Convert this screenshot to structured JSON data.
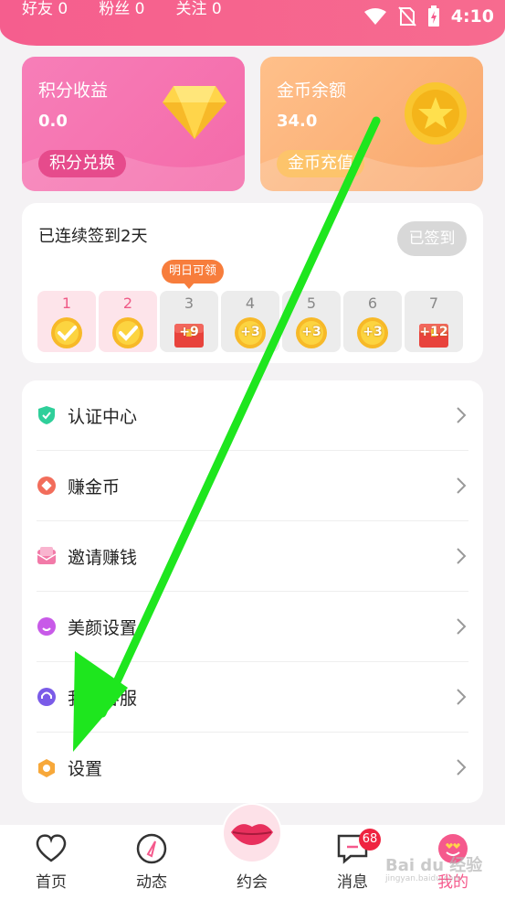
{
  "status": {
    "stats": [
      "好友 0",
      "粉丝 0",
      "关注 0"
    ],
    "time": "4:10"
  },
  "points_card": {
    "title": "积分收益",
    "value": "0.0",
    "button": "积分兑换"
  },
  "coin_card": {
    "title": "金币余额",
    "value": "34.0",
    "button": "金币充值"
  },
  "signin": {
    "title": "已连续签到2天",
    "button": "已签到",
    "tip": "明日可领",
    "days": [
      {
        "num": "1",
        "reward": "",
        "state": "done"
      },
      {
        "num": "2",
        "reward": "",
        "state": "done"
      },
      {
        "num": "3",
        "reward": "+9",
        "state": "chest"
      },
      {
        "num": "4",
        "reward": "+3",
        "state": "coin"
      },
      {
        "num": "5",
        "reward": "+3",
        "state": "coin"
      },
      {
        "num": "6",
        "reward": "+3",
        "state": "coin"
      },
      {
        "num": "7",
        "reward": "+12",
        "state": "chest"
      }
    ]
  },
  "menu": [
    {
      "label": "认证中心",
      "icon": "shield-check-icon"
    },
    {
      "label": "赚金币",
      "icon": "diamond-coin-icon"
    },
    {
      "label": "邀请赚钱",
      "icon": "envelope-icon"
    },
    {
      "label": "美颜设置",
      "icon": "beauty-face-icon"
    },
    {
      "label": "我的客服",
      "icon": "headset-icon"
    },
    {
      "label": "设置",
      "icon": "gear-icon"
    }
  ],
  "tabs": [
    {
      "label": "首页",
      "icon": "heart-icon"
    },
    {
      "label": "动态",
      "icon": "compass-icon"
    },
    {
      "label": "约会",
      "icon": "lips-icon"
    },
    {
      "label": "消息",
      "icon": "chat-icon",
      "badge": "68"
    },
    {
      "label": "我的",
      "icon": "love-face-icon",
      "active": true
    }
  ],
  "watermark": {
    "text": "Bai du 经验",
    "sub": "jingyan.baidu.com"
  },
  "colors": {
    "accent": "#f5598c",
    "arrow": "#1ee61e"
  }
}
